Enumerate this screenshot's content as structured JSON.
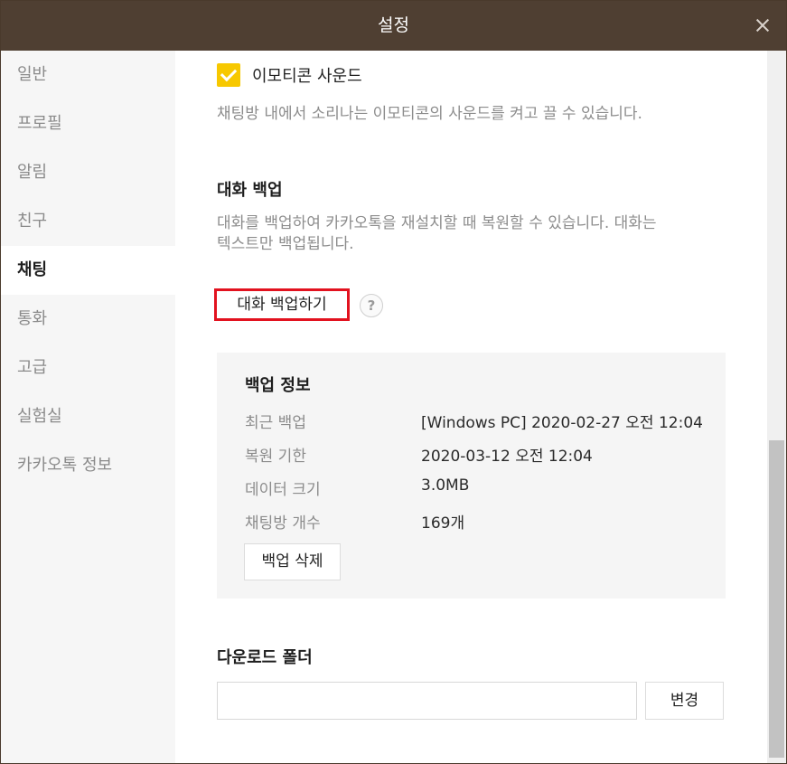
{
  "window": {
    "title": "설정"
  },
  "sidebar": {
    "items": [
      {
        "label": "일반"
      },
      {
        "label": "프로필"
      },
      {
        "label": "알림"
      },
      {
        "label": "친구"
      },
      {
        "label": "채팅"
      },
      {
        "label": "통화"
      },
      {
        "label": "고급"
      },
      {
        "label": "실험실"
      },
      {
        "label": "카카오톡 정보"
      }
    ],
    "active": "채팅"
  },
  "emoticon_sound": {
    "checked": true,
    "label": "이모티콘 사운드",
    "description": "채팅방 내에서 소리나는 이모티콘의 사운드를 켜고 끌 수 있습니다."
  },
  "chat_backup": {
    "title": "대화 백업",
    "description_line1": "대화를 백업하여 카카오톡을 재설치할 때 복원할 수 있습니다. 대화는",
    "description_line2": "텍스트만 백업됩니다.",
    "button_label": "대화 백업하기",
    "help_symbol": "?"
  },
  "backup_info": {
    "title": "백업 정보",
    "rows": [
      {
        "label": "최근 백업",
        "value": "[Windows PC] 2020-02-27 오전 12:04"
      },
      {
        "label": "복원 기한",
        "value": "2020-03-12 오전 12:04"
      },
      {
        "label": "데이터 크기",
        "value": "3.0MB"
      },
      {
        "label": "채팅방 개수",
        "value": "169개"
      }
    ],
    "delete_label": "백업 삭제"
  },
  "download_folder": {
    "title": "다운로드 폴더",
    "path": "",
    "change_label": "변경"
  },
  "colors": {
    "titlebar": "#4f3f32",
    "checkbox": "#f7c800",
    "highlight": "#e2121f"
  }
}
